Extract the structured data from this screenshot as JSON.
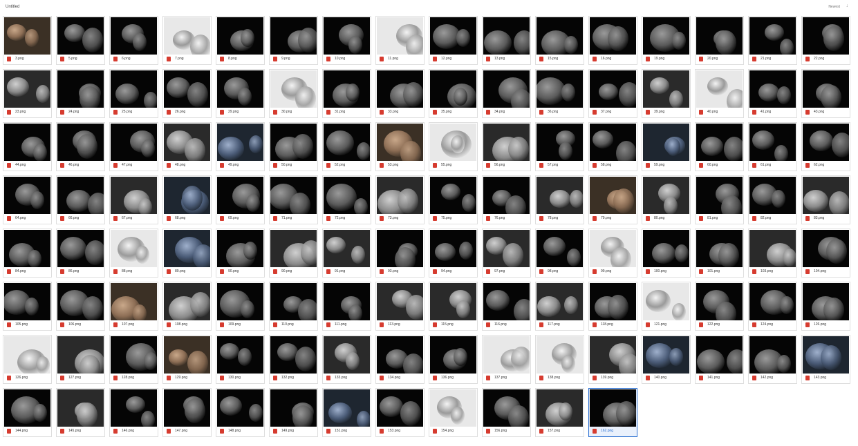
{
  "header": {
    "folder_title": "Untitled",
    "sort_label": "Newest",
    "sort_icon": "arrow-down-icon"
  },
  "files": [
    {
      "name": "3.png",
      "tone": "warm"
    },
    {
      "name": "5.png",
      "tone": "dark"
    },
    {
      "name": "6.png",
      "tone": "dark"
    },
    {
      "name": "7.png",
      "tone": "light"
    },
    {
      "name": "8.png",
      "tone": "dark"
    },
    {
      "name": "9.png",
      "tone": "dark"
    },
    {
      "name": "10.png",
      "tone": "dark"
    },
    {
      "name": "11.png",
      "tone": "light"
    },
    {
      "name": "12.png",
      "tone": "dark"
    },
    {
      "name": "13.png",
      "tone": "dark"
    },
    {
      "name": "15.png",
      "tone": "dark"
    },
    {
      "name": "16.png",
      "tone": "dark"
    },
    {
      "name": "19.png",
      "tone": "dark"
    },
    {
      "name": "20.png",
      "tone": "dark"
    },
    {
      "name": "21.png",
      "tone": "dark"
    },
    {
      "name": "22.png",
      "tone": "dark"
    },
    {
      "name": "23.png",
      "tone": "grey"
    },
    {
      "name": "24.png",
      "tone": "dark"
    },
    {
      "name": "25.png",
      "tone": "dark"
    },
    {
      "name": "26.png",
      "tone": "dark"
    },
    {
      "name": "29.png",
      "tone": "dark"
    },
    {
      "name": "30.png",
      "tone": "light"
    },
    {
      "name": "31.png",
      "tone": "dark"
    },
    {
      "name": "33.png",
      "tone": "dark"
    },
    {
      "name": "35.png",
      "tone": "dark"
    },
    {
      "name": "34.png",
      "tone": "dark"
    },
    {
      "name": "36.png",
      "tone": "dark"
    },
    {
      "name": "37.png",
      "tone": "dark"
    },
    {
      "name": "39.png",
      "tone": "grey"
    },
    {
      "name": "40.png",
      "tone": "light"
    },
    {
      "name": "41.png",
      "tone": "dark"
    },
    {
      "name": "43.png",
      "tone": "dark"
    },
    {
      "name": "44.png",
      "tone": "dark"
    },
    {
      "name": "46.png",
      "tone": "dark"
    },
    {
      "name": "47.png",
      "tone": "dark"
    },
    {
      "name": "48.png",
      "tone": "grey"
    },
    {
      "name": "49.png",
      "tone": "blue"
    },
    {
      "name": "50.png",
      "tone": "dark"
    },
    {
      "name": "52.png",
      "tone": "dark"
    },
    {
      "name": "53.png",
      "tone": "warm"
    },
    {
      "name": "55.png",
      "tone": "light"
    },
    {
      "name": "56.png",
      "tone": "grey"
    },
    {
      "name": "57.png",
      "tone": "dark"
    },
    {
      "name": "58.png",
      "tone": "dark"
    },
    {
      "name": "59.png",
      "tone": "blue"
    },
    {
      "name": "60.png",
      "tone": "dark"
    },
    {
      "name": "61.png",
      "tone": "dark"
    },
    {
      "name": "62.png",
      "tone": "dark"
    },
    {
      "name": "64.png",
      "tone": "dark"
    },
    {
      "name": "66.png",
      "tone": "dark"
    },
    {
      "name": "67.png",
      "tone": "grey"
    },
    {
      "name": "68.png",
      "tone": "blue"
    },
    {
      "name": "69.png",
      "tone": "dark"
    },
    {
      "name": "71.png",
      "tone": "dark"
    },
    {
      "name": "72.png",
      "tone": "dark"
    },
    {
      "name": "73.png",
      "tone": "grey"
    },
    {
      "name": "75.png",
      "tone": "dark"
    },
    {
      "name": "76.png",
      "tone": "dark"
    },
    {
      "name": "78.png",
      "tone": "grey"
    },
    {
      "name": "79.png",
      "tone": "warm"
    },
    {
      "name": "80.png",
      "tone": "grey"
    },
    {
      "name": "81.png",
      "tone": "dark"
    },
    {
      "name": "82.png",
      "tone": "dark"
    },
    {
      "name": "83.png",
      "tone": "grey"
    },
    {
      "name": "84.png",
      "tone": "dark"
    },
    {
      "name": "86.png",
      "tone": "dark"
    },
    {
      "name": "88.png",
      "tone": "light"
    },
    {
      "name": "89.png",
      "tone": "blue"
    },
    {
      "name": "90.png",
      "tone": "dark"
    },
    {
      "name": "90.png",
      "tone": "grey"
    },
    {
      "name": "91.png",
      "tone": "grey"
    },
    {
      "name": "93.png",
      "tone": "dark"
    },
    {
      "name": "94.png",
      "tone": "dark"
    },
    {
      "name": "97.png",
      "tone": "grey"
    },
    {
      "name": "98.png",
      "tone": "dark"
    },
    {
      "name": "99.png",
      "tone": "light"
    },
    {
      "name": "100.png",
      "tone": "dark"
    },
    {
      "name": "101.png",
      "tone": "dark"
    },
    {
      "name": "103.png",
      "tone": "grey"
    },
    {
      "name": "104.png",
      "tone": "dark"
    },
    {
      "name": "105.png",
      "tone": "dark"
    },
    {
      "name": "106.png",
      "tone": "dark"
    },
    {
      "name": "107.png",
      "tone": "warm"
    },
    {
      "name": "108.png",
      "tone": "grey"
    },
    {
      "name": "109.png",
      "tone": "dark"
    },
    {
      "name": "110.png",
      "tone": "dark"
    },
    {
      "name": "111.png",
      "tone": "dark"
    },
    {
      "name": "113.png",
      "tone": "grey"
    },
    {
      "name": "115.png",
      "tone": "grey"
    },
    {
      "name": "116.png",
      "tone": "dark"
    },
    {
      "name": "117.png",
      "tone": "grey"
    },
    {
      "name": "118.png",
      "tone": "dark"
    },
    {
      "name": "121.png",
      "tone": "light"
    },
    {
      "name": "122.png",
      "tone": "dark"
    },
    {
      "name": "124.png",
      "tone": "dark"
    },
    {
      "name": "126.png",
      "tone": "dark"
    },
    {
      "name": "126.png",
      "tone": "light"
    },
    {
      "name": "127.png",
      "tone": "grey"
    },
    {
      "name": "128.png",
      "tone": "dark"
    },
    {
      "name": "129.png",
      "tone": "warm"
    },
    {
      "name": "130.png",
      "tone": "dark"
    },
    {
      "name": "132.png",
      "tone": "dark"
    },
    {
      "name": "133.png",
      "tone": "grey"
    },
    {
      "name": "134.png",
      "tone": "dark"
    },
    {
      "name": "136.png",
      "tone": "dark"
    },
    {
      "name": "137.png",
      "tone": "light"
    },
    {
      "name": "138.png",
      "tone": "light"
    },
    {
      "name": "139.png",
      "tone": "grey"
    },
    {
      "name": "140.png",
      "tone": "blue"
    },
    {
      "name": "141.png",
      "tone": "dark"
    },
    {
      "name": "142.png",
      "tone": "dark"
    },
    {
      "name": "143.png",
      "tone": "blue"
    },
    {
      "name": "144.png",
      "tone": "dark"
    },
    {
      "name": "145.png",
      "tone": "grey"
    },
    {
      "name": "146.png",
      "tone": "dark"
    },
    {
      "name": "147.png",
      "tone": "dark"
    },
    {
      "name": "148.png",
      "tone": "dark"
    },
    {
      "name": "149.png",
      "tone": "dark"
    },
    {
      "name": "151.png",
      "tone": "blue"
    },
    {
      "name": "153.png",
      "tone": "dark"
    },
    {
      "name": "154.png",
      "tone": "light"
    },
    {
      "name": "156.png",
      "tone": "dark"
    },
    {
      "name": "157.png",
      "tone": "grey"
    },
    {
      "name": "162.png",
      "tone": "dark",
      "selected": true
    }
  ]
}
